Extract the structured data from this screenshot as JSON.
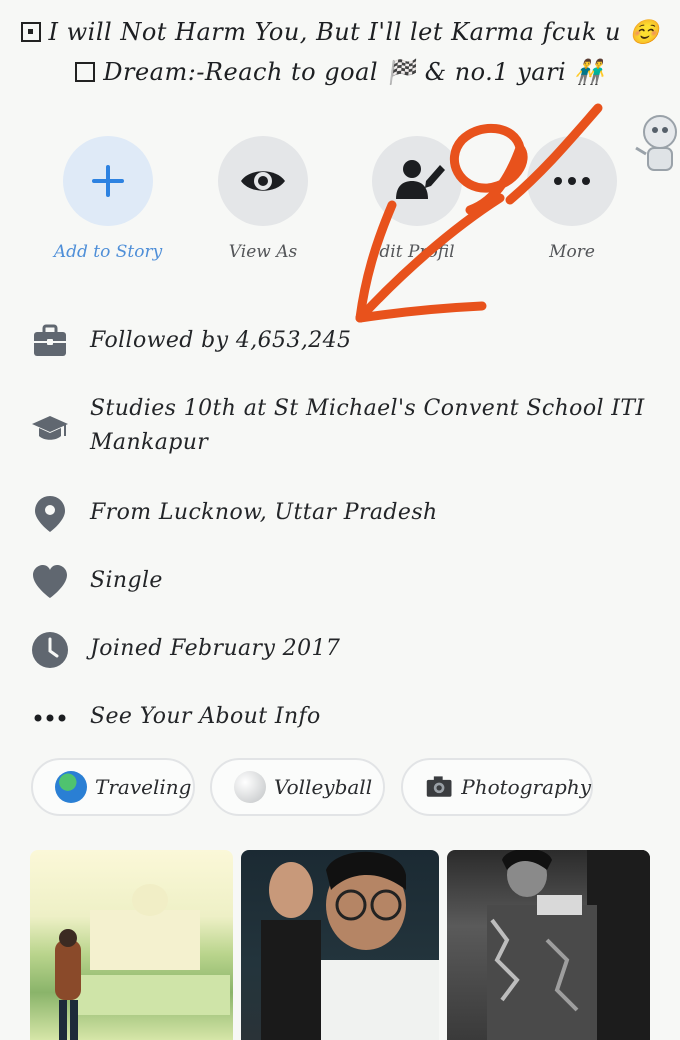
{
  "bio": {
    "line1": "I will Not Harm You, But I'll let Karma fcuk u ☺️",
    "line2": "Dream:-Reach to goal 🏁 & no.1 yari 👬"
  },
  "actions": [
    {
      "label": "Add to Story",
      "icon": "plus-icon"
    },
    {
      "label": "View As",
      "icon": "eye-icon"
    },
    {
      "label": "dit Profil",
      "icon": "edit-profile-icon"
    },
    {
      "label": "More",
      "icon": "more-icon"
    }
  ],
  "info": [
    {
      "text": "Followed by 4,653,245",
      "icon": "briefcase-icon"
    },
    {
      "text": "Studies 10th at St Michael's Convent School ITI",
      "text2": "Mankapur",
      "icon": "graduation-cap-icon"
    },
    {
      "text": "From Lucknow, Uttar Pradesh",
      "icon": "location-pin-icon"
    },
    {
      "text": "Single",
      "icon": "heart-icon"
    },
    {
      "text": "Joined February 2017",
      "icon": "clock-icon"
    },
    {
      "text": "See Your About Info",
      "icon": "ellipsis-icon"
    }
  ],
  "hobbies": [
    {
      "label": "Traveling",
      "emoji": "🌏"
    },
    {
      "label": "Volleyball",
      "emoji": "🏐"
    },
    {
      "label": "Photography",
      "emoji": "📷"
    }
  ],
  "colors": {
    "accent": "#2d82e1",
    "annotation": "#e8521c",
    "icon_gray": "#606770"
  }
}
